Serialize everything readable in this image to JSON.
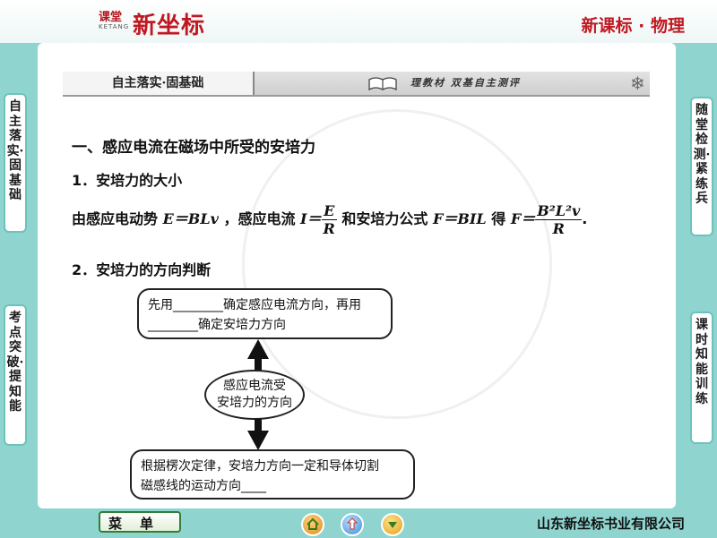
{
  "header": {
    "logo_small": "课堂",
    "logo_big": "新坐标",
    "logo_tiny": "KETANG",
    "subject": "新课标 · 物理"
  },
  "banner": {
    "left_tab": "自主落实·固基础",
    "right_text": "理教材    双基自主测评"
  },
  "side_tabs": {
    "left_top": "自主落实·固基础",
    "left_bottom": "考点突破·提知能",
    "right_top": "随堂检测·紧练兵",
    "right_bottom": "课时知能训练"
  },
  "content": {
    "heading": "一、感应电流在磁场中所受的安培力",
    "section1_title": "1．安培力的大小",
    "section1_prefix": "由感应电动势",
    "emf_formula": "E＝BLv",
    "section1_mid1": "，感应电流",
    "current_lhs": "I＝",
    "current_num": "E",
    "current_den": "R",
    "section1_mid2": "和安培力公式",
    "force_formula": "F＝BIL",
    "section1_mid3": "得",
    "force_lhs": "F＝",
    "force_num": "B²L²v",
    "force_den": "R",
    "section1_end": ".",
    "section2_title": "2．安培力的方向判断"
  },
  "diagram": {
    "top_box_line1": "先用________确定感应电流方向，再用",
    "top_box_line2": "________确定安培力方向",
    "center_line1": "感应电流受",
    "center_line2": "安培力的方向",
    "bottom_box_line1": "根据楞次定律，安培力方向一定和导体切割",
    "bottom_box_line2": "磁感线的运动方向____"
  },
  "footer": {
    "menu_label": "菜单",
    "company": "山东新坐标书业有限公司"
  },
  "colors": {
    "background": "#8fd4cf",
    "brand_red": "#c01822",
    "nav_home": "#e08a1c",
    "nav_back": "#3a8ad8",
    "nav_next": "#e0a21c"
  }
}
